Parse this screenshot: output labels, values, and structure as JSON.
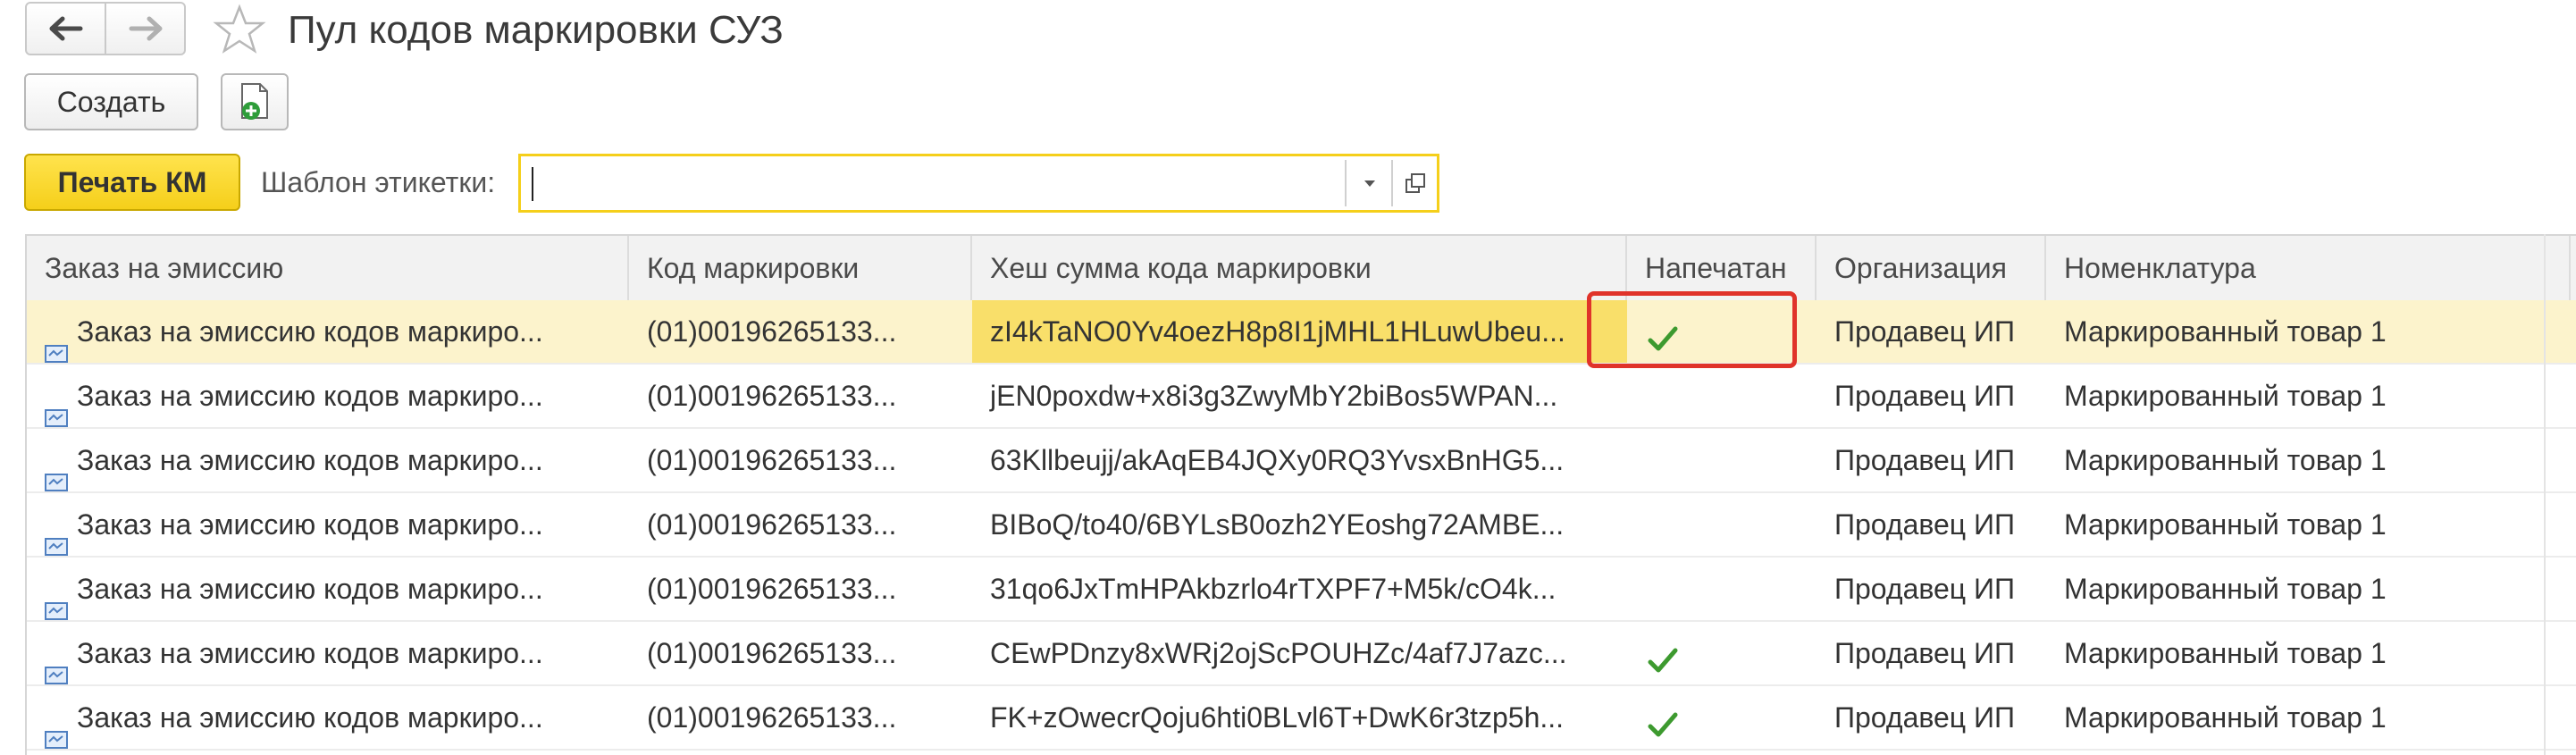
{
  "window": {
    "title": "Пул кодов маркировки СУЗ"
  },
  "toolbar": {
    "create_label": "Создать",
    "print_label": "Печать КМ",
    "template_label": "Шаблон этикетки:",
    "template_value": ""
  },
  "table": {
    "columns": [
      "Заказ на эмиссию",
      "Код маркировки",
      "Хеш сумма кода маркировки",
      "Напечатан",
      "Организация",
      "Номенклатура"
    ],
    "rows": [
      {
        "order": "Заказ на эмиссию кодов маркиро...",
        "code": "(01)00196265133...",
        "hash": "zI4kTaNO0Yv4oezH8p8I1jMHL1HLuwUbeu...",
        "printed": true,
        "org": "Продавец ИП",
        "item": "Маркированный товар 1"
      },
      {
        "order": "Заказ на эмиссию кодов маркиро...",
        "code": "(01)00196265133...",
        "hash": "jEN0poxdw+x8i3g3ZwyMbY2biBos5WPAN...",
        "printed": false,
        "org": "Продавец ИП",
        "item": "Маркированный товар 1"
      },
      {
        "order": "Заказ на эмиссию кодов маркиро...",
        "code": "(01)00196265133...",
        "hash": "63Kllbeujj/akAqEB4JQXy0RQ3YvsxBnHG5...",
        "printed": false,
        "org": "Продавец ИП",
        "item": "Маркированный товар 1"
      },
      {
        "order": "Заказ на эмиссию кодов маркиро...",
        "code": "(01)00196265133...",
        "hash": "BIBoQ/to40/6BYLsB0ozh2YEoshg72AMBE...",
        "printed": false,
        "org": "Продавец ИП",
        "item": "Маркированный товар 1"
      },
      {
        "order": "Заказ на эмиссию кодов маркиро...",
        "code": "(01)00196265133...",
        "hash": "31qo6JxTmHPAkbzrlo4rTXPF7+M5k/cO4k...",
        "printed": false,
        "org": "Продавец ИП",
        "item": "Маркированный товар 1"
      },
      {
        "order": "Заказ на эмиссию кодов маркиро...",
        "code": "(01)00196265133...",
        "hash": "CEwPDnzy8xWRj2ojScPOUHZc/4af7J7azc...",
        "printed": true,
        "org": "Продавец ИП",
        "item": "Маркированный товар 1"
      },
      {
        "order": "Заказ на эмиссию кодов маркиро...",
        "code": "(01)00196265133...",
        "hash": "FK+zOwecrQoju6hti0BLvl6T+DwK6r3tzp5h...",
        "printed": true,
        "org": "Продавец ИП",
        "item": "Маркированный товар 1"
      }
    ]
  },
  "colors": {
    "accent_yellow": "#f5cf1a",
    "selected_row": "#fcf3cc",
    "check_green": "#3d9a2f",
    "highlight_red": "#e0332a"
  },
  "icons": [
    "back-arrow-icon",
    "forward-arrow-icon",
    "star-icon",
    "add-copy-icon",
    "dropdown-arrow-icon",
    "open-window-icon",
    "document-icon",
    "checkmark-icon"
  ]
}
